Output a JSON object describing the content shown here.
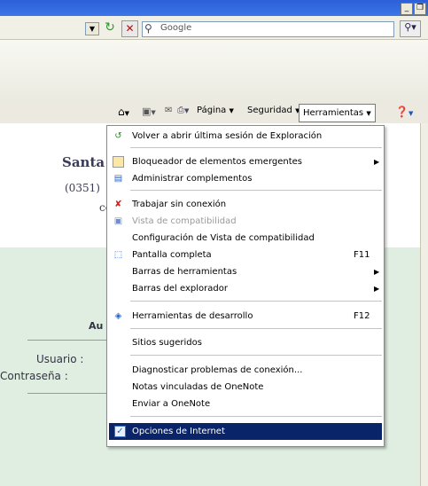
{
  "search": {
    "placeholder": "Google"
  },
  "commandbar": {
    "pagina": "Página",
    "seguridad": "Seguridad",
    "herramientas": "Herramientas"
  },
  "page": {
    "brand_fragment": "Santa",
    "phone_fragment": "(0351)",
    "line3_fragment": "cc",
    "auth_fragment": "Au",
    "usuario_label": "Usuario :",
    "contrasena_label": "Contraseña :"
  },
  "menu": {
    "items": [
      {
        "label": "Volver a abrir última sesión de Exploración",
        "icon": "reopen-session-icon"
      },
      {
        "label": "Bloqueador de elementos emergentes",
        "icon": "popup-blocker-icon",
        "submenu": true
      },
      {
        "label": "Administrar complementos",
        "icon": "addons-icon"
      },
      {
        "label": "Trabajar sin conexión",
        "icon": "offline-icon"
      },
      {
        "label": "Vista de compatibilidad",
        "icon": "compat-view-icon",
        "disabled": true
      },
      {
        "label": "Configuración de Vista de compatibilidad"
      },
      {
        "label": "Pantalla completa",
        "icon": "fullscreen-icon",
        "shortcut": "F11"
      },
      {
        "label": "Barras de herramientas",
        "submenu": true
      },
      {
        "label": "Barras del explorador",
        "submenu": true
      },
      {
        "label": "Herramientas de desarrollo",
        "icon": "dev-tools-icon",
        "shortcut": "F12"
      },
      {
        "label": "Sitios sugeridos"
      },
      {
        "label": "Diagnosticar problemas de conexión..."
      },
      {
        "label": "Notas vinculadas de OneNote"
      },
      {
        "label": "Enviar a OneNote"
      },
      {
        "label": "Opciones de Internet",
        "icon": "internet-options-icon",
        "highlighted": true
      }
    ]
  },
  "colors": {
    "highlight": "#0a246a",
    "green_panel": "#dfeee0"
  }
}
